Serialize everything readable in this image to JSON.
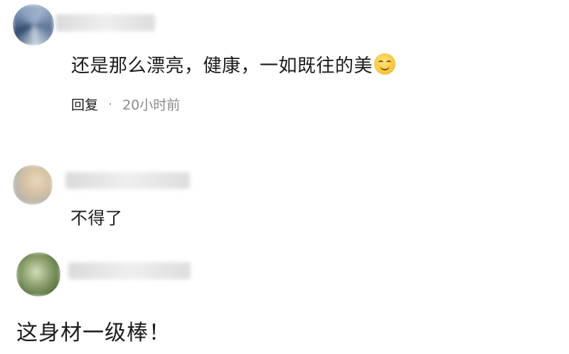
{
  "comments": [
    {
      "text": "还是那么漂亮，健康，一如既往的美",
      "emoji": "smiling-face-emoji",
      "reply_label": "回复",
      "separator": "·",
      "time": "20小时前"
    },
    {
      "text": "不得了"
    },
    {
      "text": "这身材一级棒！"
    }
  ]
}
